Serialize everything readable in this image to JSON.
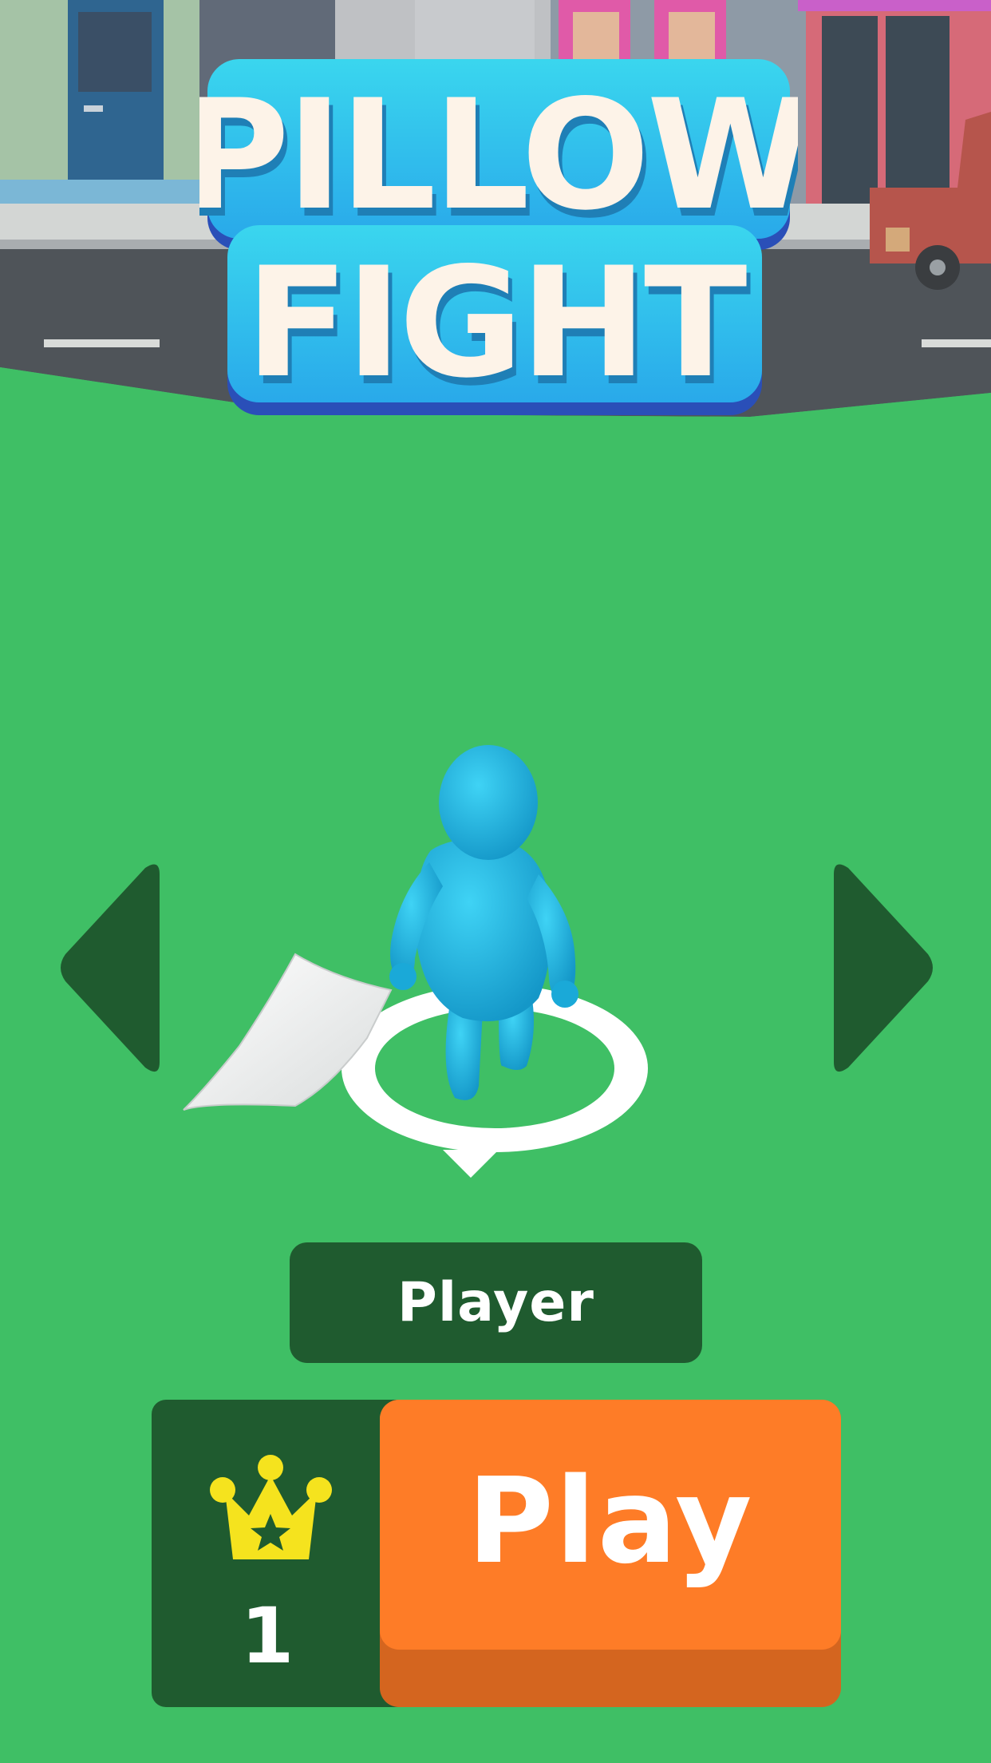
{
  "game": {
    "title_line1": "PILLOW",
    "title_line2": "FIGHT",
    "player_name": "Player",
    "level": "1",
    "play_label": "Play"
  },
  "icons": {
    "left_arrow": "triangle-left",
    "right_arrow": "triangle-right",
    "crown": "crown-with-star"
  },
  "colors": {
    "ground": "#3fbf65",
    "dark_panel": "#1f5b2f",
    "play_orange": "#fe7c27",
    "play_shadow": "#d4651f",
    "character_blue": "#1ab8e0",
    "crown_yellow": "#f5e31e",
    "title_blue": "#27b6e8"
  }
}
